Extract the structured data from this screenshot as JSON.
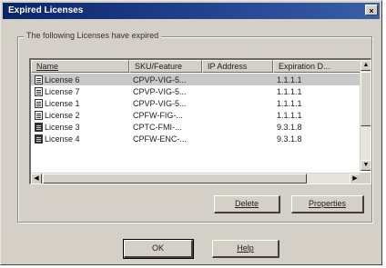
{
  "window": {
    "title": "Expired Licenses",
    "close_glyph": "×"
  },
  "group": {
    "label": "The following Licenses have expired"
  },
  "list": {
    "columns": [
      "Name",
      "SKU/Feature",
      "IP Address",
      "Expiration D..."
    ],
    "rows": [
      {
        "name": "License 6",
        "sku": "CPVP-VIG-5...",
        "ip": "",
        "expiration": "1.1.1.1",
        "icon": "license-icon",
        "selected": true
      },
      {
        "name": "License 7",
        "sku": "CPVP-VIG-5...",
        "ip": "",
        "expiration": "1.1.1.1",
        "icon": "license-icon",
        "selected": false
      },
      {
        "name": "License 1",
        "sku": "CPVP-VIG-5...",
        "ip": "",
        "expiration": "1.1.1.1",
        "icon": "license-icon",
        "selected": false
      },
      {
        "name": "License 2",
        "sku": "CPFW-FIG-...",
        "ip": "",
        "expiration": "1.1.1.1",
        "icon": "license-icon",
        "selected": false
      },
      {
        "name": "License 3",
        "sku": "CPTC-FMI-...",
        "ip": "",
        "expiration": "9.3.1.8",
        "icon": "license-dark-icon",
        "selected": false
      },
      {
        "name": "License 4",
        "sku": "CPFW-ENC-...",
        "ip": "",
        "expiration": "9.3.1.8",
        "icon": "license-dark-icon",
        "selected": false
      }
    ]
  },
  "buttons": {
    "delete": "Delete",
    "properties": "Properties",
    "ok": "OK",
    "help": "Help"
  },
  "colors": {
    "titlebar": "#0a246a",
    "dialog_face": "#d4d0c8",
    "selected_row": "#c8c8c8"
  }
}
